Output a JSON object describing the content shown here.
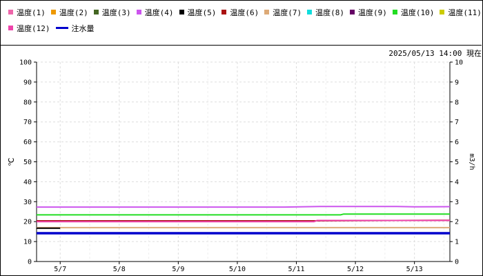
{
  "timestamp": "2025/05/13 14:00 現在",
  "legend": [
    {
      "name": "温度(1)",
      "color": "#ee66aa",
      "kind": "square"
    },
    {
      "name": "温度(2)",
      "color": "#ee9900",
      "kind": "square"
    },
    {
      "name": "温度(3)",
      "color": "#446622",
      "kind": "square"
    },
    {
      "name": "温度(4)",
      "color": "#cc55ee",
      "kind": "square"
    },
    {
      "name": "温度(5)",
      "color": "#000000",
      "kind": "square"
    },
    {
      "name": "温度(6)",
      "color": "#aa1111",
      "kind": "square"
    },
    {
      "name": "温度(7)",
      "color": "#ddaa77",
      "kind": "square"
    },
    {
      "name": "温度(8)",
      "color": "#11dddd",
      "kind": "square"
    },
    {
      "name": "温度(9)",
      "color": "#660066",
      "kind": "square"
    },
    {
      "name": "温度(10)",
      "color": "#22dd22",
      "kind": "square"
    },
    {
      "name": "温度(11)",
      "color": "#cccc00",
      "kind": "square"
    },
    {
      "name": "温度(12)",
      "color": "#ee44aa",
      "kind": "square"
    },
    {
      "name": "注水量",
      "color": "#0000cc",
      "kind": "line"
    }
  ],
  "chart_data": {
    "type": "line",
    "ylabel_left": "℃",
    "ylabel_right": "m3/h",
    "ylim_left": [
      0,
      100
    ],
    "ylim_right": [
      0,
      10
    ],
    "yticks_left": [
      "0",
      "10",
      "20",
      "30",
      "40",
      "50",
      "60",
      "70",
      "80",
      "90",
      "100"
    ],
    "yticks_right": [
      "0",
      "1",
      "2",
      "3",
      "4",
      "5",
      "6",
      "7",
      "8",
      "9",
      "10"
    ],
    "xticks": [
      "5/7",
      "5/8",
      "5/9",
      "5/10",
      "5/11",
      "5/12",
      "5/13"
    ],
    "xlim_days": [
      6.6,
      13.6
    ],
    "grid": true,
    "series": [
      {
        "name": "温度(4)",
        "color": "#cc55ee",
        "axis": "left",
        "x": [
          6.6,
          10.8,
          11.4,
          12.7,
          13.0,
          13.6
        ],
        "y": [
          27.3,
          27.3,
          27.6,
          27.6,
          27.4,
          27.5
        ]
      },
      {
        "name": "温度(10)",
        "color": "#22dd22",
        "axis": "left",
        "x": [
          6.6,
          11.75,
          11.8,
          13.6
        ],
        "y": [
          23.4,
          23.4,
          23.8,
          23.8
        ]
      },
      {
        "name": "温度(6)",
        "color": "#aa1111",
        "axis": "left",
        "x": [
          6.6,
          11.3,
          13.6
        ],
        "y": [
          20.4,
          20.4,
          20.7
        ]
      },
      {
        "name": "温度(12)",
        "color": "#ee44aa",
        "axis": "left",
        "x": [
          6.6,
          11.3,
          11.35,
          13.6
        ],
        "y": [
          20.0,
          20.0,
          20.6,
          20.6
        ]
      },
      {
        "name": "温度(7)",
        "color": "#ddaa77",
        "axis": "left",
        "x": [
          6.6,
          13.6
        ],
        "y": [
          17.0,
          17.0
        ]
      },
      {
        "name": "温度(5)",
        "color": "#000000",
        "axis": "left",
        "x": [
          6.6,
          7.0
        ],
        "y": [
          16.7,
          16.7
        ]
      },
      {
        "name": "注水量",
        "color": "#0000cc",
        "axis": "right",
        "x": [
          6.6,
          13.6
        ],
        "y": [
          1.42,
          1.42
        ]
      }
    ]
  }
}
